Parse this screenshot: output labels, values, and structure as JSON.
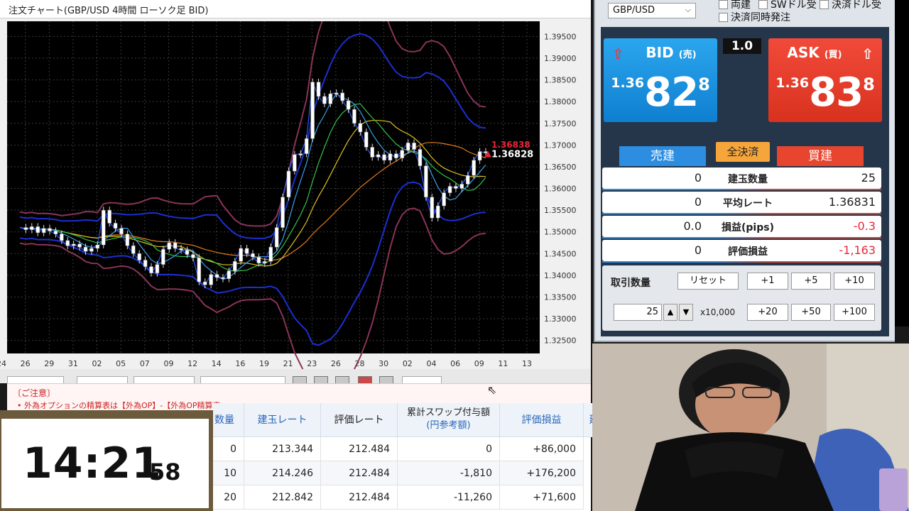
{
  "chart_window": {
    "title": "注文チャート(GBP/USD 4時間 ローソク足 BID)"
  },
  "chart_data": {
    "type": "candlestick",
    "title": "注文チャート(GBP/USD 4時間 ローソク足 BID)",
    "ylim": [
      1.322,
      1.3985
    ],
    "y_ticks": [
      "1.39500",
      "1.39000",
      "1.38500",
      "1.38000",
      "1.37500",
      "1.37000",
      "1.36500",
      "1.36000",
      "1.35500",
      "1.35000",
      "1.34500",
      "1.34000",
      "1.33500",
      "1.33000",
      "1.32500"
    ],
    "x_ticks": [
      "24",
      "26",
      "29",
      "31",
      "02",
      "05",
      "07",
      "09",
      "12",
      "14",
      "16",
      "19",
      "21",
      "23",
      "26",
      "28",
      "30",
      "02",
      "04",
      "06",
      "09",
      "11",
      "13"
    ],
    "close_series": [
      1.351,
      1.3505,
      1.3512,
      1.3498,
      1.3508,
      1.3502,
      1.3495,
      1.348,
      1.3468,
      1.3472,
      1.3465,
      1.3455,
      1.3462,
      1.347,
      1.355,
      1.352,
      1.3508,
      1.3495,
      1.3468,
      1.345,
      1.3435,
      1.342,
      1.3405,
      1.3425,
      1.346,
      1.3475,
      1.3462,
      1.3458,
      1.3448,
      1.344,
      1.3385,
      1.3378,
      1.3402,
      1.3395,
      1.3392,
      1.341,
      1.3432,
      1.3462,
      1.345,
      1.3442,
      1.3428,
      1.3432,
      1.3465,
      1.351,
      1.358,
      1.364,
      1.3678,
      1.368,
      1.3715,
      1.3845,
      1.3812,
      1.3795,
      1.3818,
      1.382,
      1.3802,
      1.3782,
      1.375,
      1.373,
      1.3695,
      1.3672,
      1.3678,
      1.3665,
      1.368,
      1.367,
      1.3688,
      1.3705,
      1.369,
      1.3652,
      1.358,
      1.3532,
      1.356,
      1.359,
      1.3605,
      1.36,
      1.361,
      1.363,
      1.3665,
      1.3685,
      1.3682
    ],
    "bid_label": "1.36828",
    "ask_label": "1.36838",
    "grid": true
  },
  "panel": {
    "pair": "GBP/USD",
    "checkbox_hedge": "両建",
    "checkbox_swap": "SWドル受",
    "checkbox_settle": "決済ドル受",
    "checkbox_settle_same": "決済同時発注",
    "bid": {
      "label": "BID",
      "label_small": "(売)",
      "price_small": "1.36",
      "price_big": "82",
      "price_sup": "8",
      "color": "#1a8ee0"
    },
    "ask": {
      "label": "ASK",
      "label_small": "(買)",
      "price_small": "1.36",
      "price_big": "83",
      "price_sup": "8",
      "color": "#e8412d"
    },
    "lot": "1.0",
    "tab_sell": "売建",
    "tab_buy": "買建",
    "close_all": "全決済",
    "rows": [
      {
        "left": "0",
        "label": "建玉数量",
        "right": "25"
      },
      {
        "left": "0",
        "label": "平均レート",
        "right": "1.36831"
      },
      {
        "left": "0.0",
        "label": "損益(pips)",
        "right": "-0.3"
      },
      {
        "left": "0",
        "label": "評価損益",
        "right": "-1,163"
      }
    ],
    "trade_label": "取引数量",
    "reset": "リセット",
    "plus1": "+1",
    "plus5": "+5",
    "plus10": "+10",
    "plus20": "+20",
    "plus50": "+50",
    "plus100": "+100",
    "qty_value": "25",
    "unit": "x10,000"
  },
  "notice": {
    "title": "〔ご注意〕",
    "text": "• 外為オプションの精算表は【外為OP】-【外為OP精算表"
  },
  "table": {
    "headers": {
      "qty": "数量",
      "open_rate": "建玉レート",
      "eval_rate": "評価レート",
      "swap_line1": "累計スワップ付与額",
      "swap_line2": "(円参考額)",
      "pl": "評価損益",
      "more": "建"
    },
    "rows": [
      {
        "qty": "0",
        "open_rate": "213.344",
        "eval_rate": "212.484",
        "swap": "0",
        "pl": "+86,000"
      },
      {
        "qty": "10",
        "open_rate": "214.246",
        "eval_rate": "212.484",
        "swap": "-1,810",
        "pl": "+176,200"
      },
      {
        "qty": "20",
        "open_rate": "212.842",
        "eval_rate": "212.484",
        "swap": "-11,260",
        "pl": "+71,600"
      }
    ]
  },
  "clock": {
    "hm": "14:21",
    "sec": "58"
  }
}
